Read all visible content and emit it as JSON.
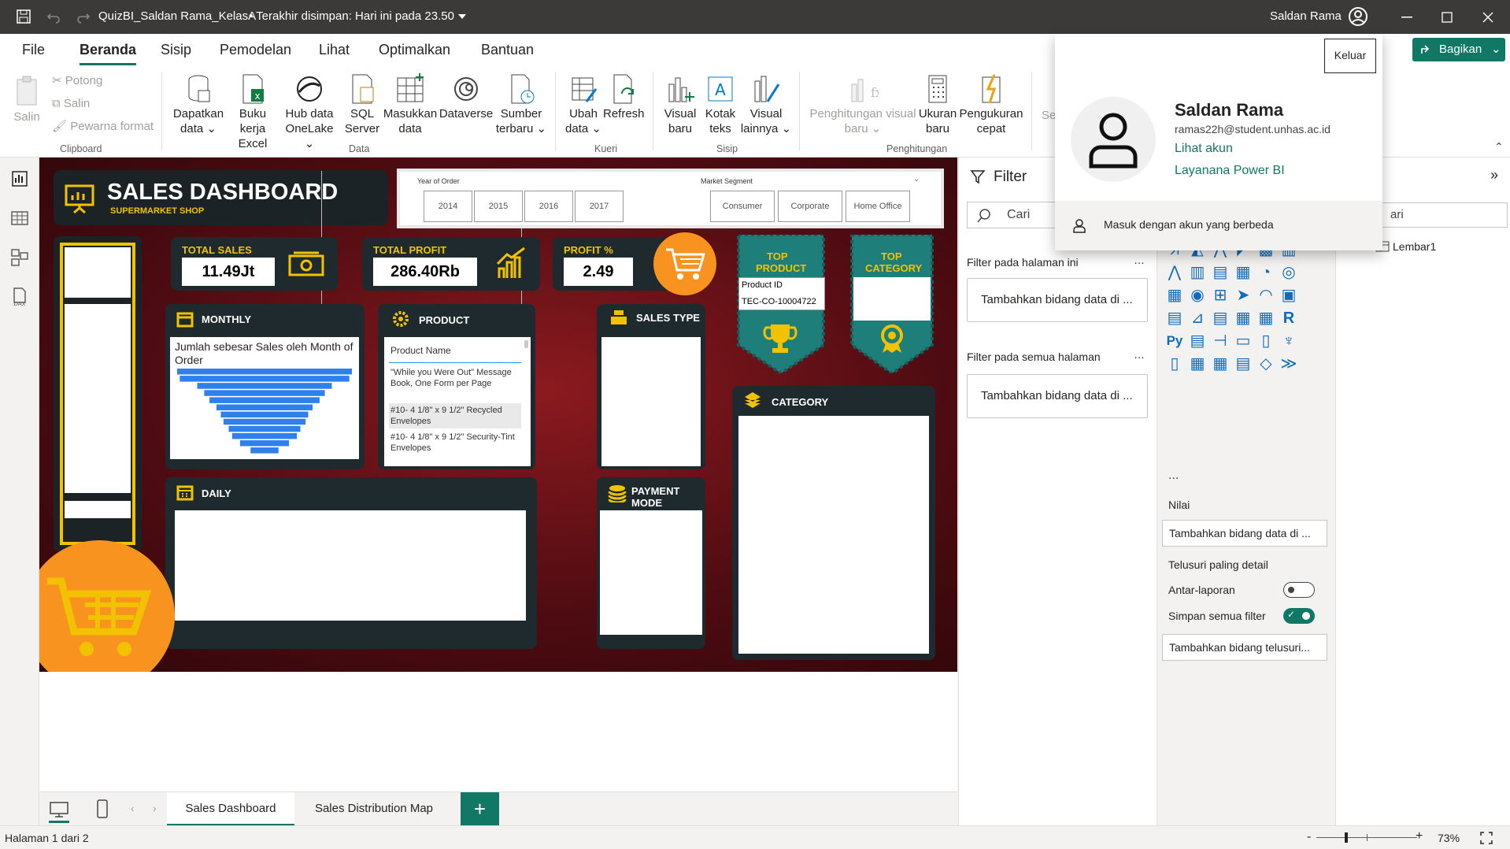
{
  "titlebar": {
    "file_title": "QuizBI_Saldan Rama_KelasA",
    "saved": "• Terakhir disimpan: Hari ini pada 23.50",
    "user": "Saldan Rama"
  },
  "menu_tabs": [
    "File",
    "Beranda",
    "Sisip",
    "Pemodelan",
    "Lihat",
    "Optimalkan",
    "Bantuan"
  ],
  "share": "Bagikan",
  "ribbon": {
    "clipboard": {
      "paste": "Salin",
      "cut": "Potong",
      "copy": "Salin",
      "format": "Pewarna format",
      "group": "Clipboard"
    },
    "data": {
      "get_data": [
        "Dapatkan",
        "data"
      ],
      "excel": [
        "Buku kerja",
        "Excel"
      ],
      "onelake": [
        "Hub data",
        "OneLake"
      ],
      "sql": [
        "SQL",
        "Server"
      ],
      "enter": [
        "Masukkan",
        "data"
      ],
      "dataverse": "Dataverse",
      "recent": [
        "Sumber",
        "terbaru"
      ],
      "group": "Data"
    },
    "query": {
      "transform": [
        "Ubah",
        "data"
      ],
      "refresh": "Refresh",
      "group": "Kueri"
    },
    "insert": {
      "visual": [
        "Visual",
        "baru"
      ],
      "textbox": [
        "Kotak",
        "teks"
      ],
      "more": [
        "Visual",
        "lainnya"
      ],
      "group": "Sisip"
    },
    "calc": {
      "visual_calc": [
        "Penghitungan visual",
        "baru"
      ],
      "measure": [
        "Ukuran",
        "baru"
      ],
      "quick": [
        "Pengukuran",
        "cepat"
      ],
      "group": "Penghitungan",
      "cut_label": "Se"
    }
  },
  "dashboard": {
    "title": "SALES DASHBOARD",
    "subtitle": "SUPERMARKET SHOP",
    "year_label": "Year of Order",
    "years": [
      "2014",
      "2015",
      "2016",
      "2017"
    ],
    "segment_label": "Market Segment",
    "segments": [
      "Consumer",
      "Corporate",
      "Home Office"
    ],
    "kpis": [
      {
        "label": "TOTAL SALES",
        "value": "11.49Jt"
      },
      {
        "label": "TOTAL PROFIT",
        "value": "286.40Rb"
      },
      {
        "label": "PROFIT %",
        "value": "2.49"
      }
    ],
    "top_product": {
      "title": [
        "TOP",
        "PRODUCT"
      ],
      "field": "Product ID",
      "value": "TEC-CO-10004722"
    },
    "top_category": {
      "title": [
        "TOP",
        "CATEGORY"
      ]
    },
    "monthly": {
      "title": "MONTHLY",
      "chart_title": "Jumlah sebesar Sales oleh Month of Order"
    },
    "product": {
      "title": "PRODUCT",
      "header": "Product Name",
      "rows": [
        "\"While you Were Out\" Message Book, One Form per Page",
        "#10- 4 1/8\" x 9 1/2\" Recycled Envelopes",
        "#10- 4 1/8\" x 9 1/2\" Security-Tint Envelopes"
      ]
    },
    "sales_type": "SALES TYPE",
    "category": "CATEGORY",
    "daily": "DAILY",
    "payment": "PAYMENT MODE"
  },
  "chart_data": {
    "type": "bar",
    "title": "Jumlah sebesar Sales oleh Month of Order",
    "orientation": "horizontal-funnel",
    "categories": [
      "",
      "",
      "",
      "",
      "",
      "",
      "",
      "",
      "",
      "",
      "",
      ""
    ],
    "values": [
      100,
      97,
      77,
      69,
      63,
      55,
      50,
      47,
      41,
      37,
      28,
      16
    ],
    "xlabel": "",
    "ylabel": ""
  },
  "filters": {
    "title": "Filter",
    "search": "Cari",
    "page": "Filter pada halaman ini",
    "add_page": "Tambahkan bidang data di ...",
    "all": "Filter pada semua halaman",
    "add_all": "Tambahkan bidang data di ..."
  },
  "viz": {
    "value_label": "Nilai",
    "add_value": "Tambahkan bidang data di ...",
    "drill": "Telusuri paling detail",
    "cross": "Antar-laporan",
    "keep": "Simpan semua filter",
    "add_drill": "Tambahkan bidang telusuri...",
    "more": "..."
  },
  "datapane": {
    "search_cut": "ari",
    "table": "Lembar1"
  },
  "account": {
    "signout": "Keluar",
    "name": "Saldan Rama",
    "email": "ramas22h@student.unhas.ac.id",
    "view": "Lihat akun",
    "service": "Layanana Power BI",
    "other": "Masuk dengan akun yang berbeda"
  },
  "pages": [
    "Sales Dashboard",
    "Sales Distribution Map"
  ],
  "status": {
    "page": "Halaman 1 dari 2",
    "zoom": "73%",
    "minus": "-",
    "plus": "+"
  },
  "colors": {
    "accent": "#117865",
    "brand_yellow": "#f2c200",
    "orange": "#f7931e",
    "teal": "#1e7f7a",
    "dark_card": "#1f2a2e",
    "maroon": "#5a0c14"
  }
}
